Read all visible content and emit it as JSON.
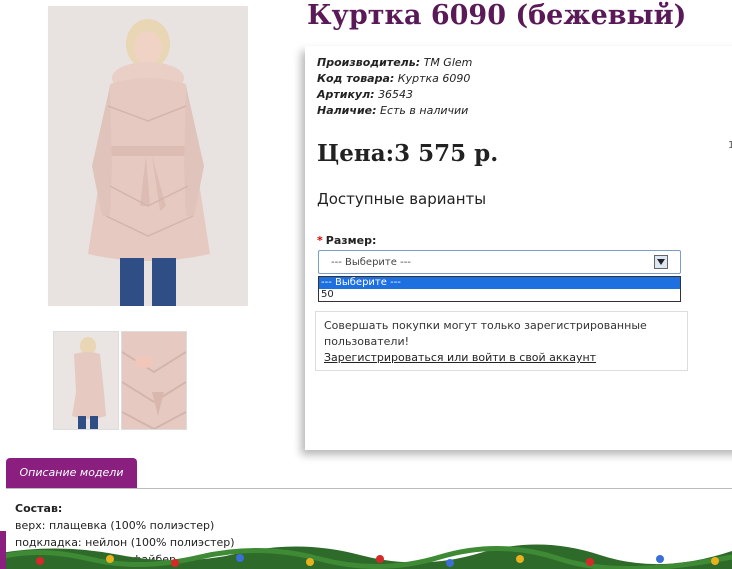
{
  "product": {
    "title": "Куртка 6090 (бежевый)",
    "images": {
      "main": "product-photo",
      "thumbnails": [
        "thumbnail-photo-1",
        "thumbnail-photo-2"
      ]
    }
  },
  "info": {
    "manufacturer_label": "Производитель:",
    "manufacturer_value": "TM Glem",
    "code_label": "Код товара:",
    "code_value": "Куртка 6090",
    "sku_label": "Артикул:",
    "sku_value": "36543",
    "availability_label": "Наличие:",
    "availability_value": "Есть в наличии"
  },
  "price_text": "Цена:3 575 р.",
  "options": {
    "title": "Доступные варианты",
    "required_mark": "*",
    "size_label": "Размер:",
    "select_value": "--- Выберите ---",
    "dropdown_options": [
      "--- Выберите ---",
      "50"
    ]
  },
  "notice": {
    "text": "Совершать покупки могут только зарегистрированные пользователи!",
    "link": "Зарегистрироваться или войти в свой аккаунт"
  },
  "right_marker": "1",
  "description": {
    "tab_label": "Описание модели",
    "composition_label": "Состав:",
    "lines": [
      "верх: плащевка (100% полиэстер)",
      "подкладка: нейлон (100% полиэстер)",
      "наполнитель: холлофайбер"
    ]
  },
  "colors": {
    "accent": "#8a1f80",
    "title": "#5a1a57",
    "selection": "#1e6fe0"
  }
}
